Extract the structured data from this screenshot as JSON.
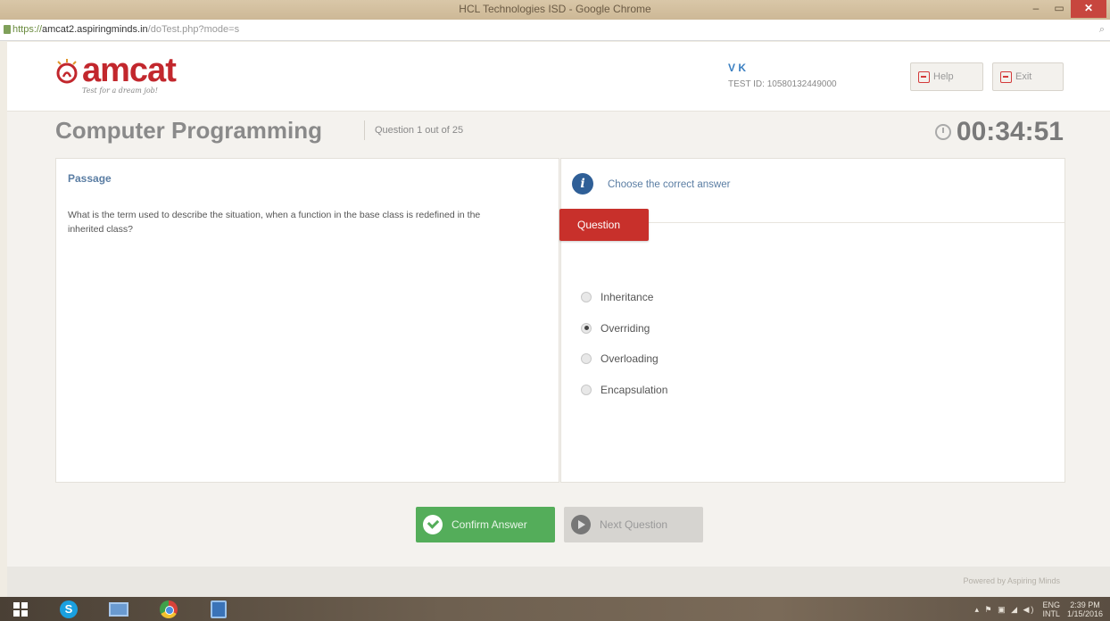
{
  "browser": {
    "window_title": "HCL Technologies ISD - Google Chrome",
    "url_scheme": "https://",
    "url_host": "amcat2.aspiringminds.in",
    "url_path": "/doTest.php?mode=s",
    "window_controls": {
      "minimize": "–",
      "maximize": "▭",
      "close": "✕"
    }
  },
  "header": {
    "logo_text": "amcat",
    "tagline": "Test for a dream job!",
    "user_name": "V K",
    "test_id": "TEST ID: 10580132449000",
    "help_label": "Help",
    "exit_label": "Exit"
  },
  "test": {
    "subject": "Computer Programming",
    "question_progress": "Question 1 out of 25",
    "timer": "00:34:51"
  },
  "passage": {
    "title": "Passage",
    "text": "What is the term used to describe the situation, when a function in the base class is redefined in the inherited class?"
  },
  "question": {
    "instruction": "Choose the correct answer",
    "tab_label": "Question",
    "options": [
      {
        "label": "Inheritance",
        "selected": false
      },
      {
        "label": "Overriding",
        "selected": true
      },
      {
        "label": "Overloading",
        "selected": false
      },
      {
        "label": "Encapsulation",
        "selected": false
      }
    ]
  },
  "actions": {
    "confirm_label": "Confirm Answer",
    "next_label": "Next Question"
  },
  "footer": {
    "powered_by": "Powered by Aspiring Minds"
  },
  "taskbar": {
    "items": [
      "start-icon",
      "skype-icon",
      "explorer-icon",
      "chrome-icon",
      "app-icon"
    ],
    "skype_glyph": "S",
    "lang": "ENG",
    "region": "INTL",
    "time": "2:39 PM",
    "date": "1/15/2016"
  },
  "colors": {
    "brand_red": "#c2272d",
    "question_tab": "#c8302b",
    "confirm_green": "#54ad5a",
    "info_blue": "#2f5f97",
    "link_blue": "#5a7da3"
  }
}
